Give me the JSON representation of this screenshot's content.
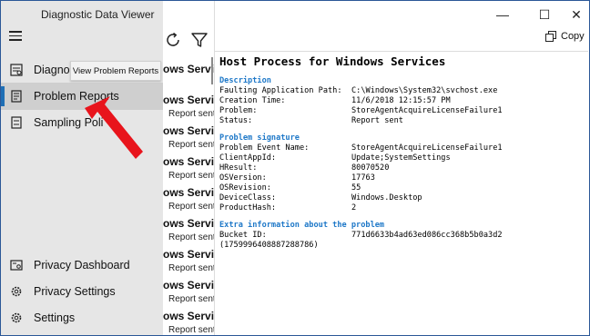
{
  "app": {
    "title": "Diagnostic Data Viewer"
  },
  "window_controls": {
    "minimize": "—",
    "maximize": "☐",
    "close": "✕"
  },
  "colors": {
    "accent": "#1f6fb5",
    "section_heading": "#1e78c8",
    "arrow": "#e8141c",
    "nav_bg": "#e6e6e6"
  },
  "nav": {
    "items": [
      {
        "label": "Diagnos",
        "icon": "diagnostic-icon"
      },
      {
        "label": "Problem Reports",
        "icon": "problem-reports-icon"
      },
      {
        "label": "Sampling Poli",
        "icon": "sampling-icon"
      },
      {
        "label": "Privacy Dashboard",
        "icon": "privacy-dashboard-icon"
      },
      {
        "label": "Privacy Settings",
        "icon": "gear-icon"
      },
      {
        "label": "Settings",
        "icon": "gear-icon"
      }
    ],
    "tooltip": "View Problem Reports"
  },
  "toolbar": {
    "refresh_icon": "refresh-icon",
    "filter_icon": "filter-icon",
    "copy_label": "Copy"
  },
  "list": {
    "items": [
      {
        "title": "ows Services...",
        "status": ""
      },
      {
        "title": "ows Servic...",
        "status": "Report sent"
      },
      {
        "title": "ows Servic...",
        "status": "Report sent"
      },
      {
        "title": "ows Servic...",
        "status": "Report sent"
      },
      {
        "title": "ows Servic...",
        "status": "Report sent"
      },
      {
        "title": "ows Servic...",
        "status": "Report sent"
      },
      {
        "title": "ows Servic...",
        "status": "Report sent"
      },
      {
        "title": "ows Servic...",
        "status": "Report sent"
      },
      {
        "title": "ows Servic...",
        "status": "Report sent"
      }
    ]
  },
  "detail": {
    "title": "Host Process for Windows Services",
    "description_heading": "Description",
    "description": [
      {
        "key": "Faulting Application Path:",
        "value": "C:\\Windows\\System32\\svchost.exe"
      },
      {
        "key": "Creation Time:",
        "value": "11/6/2018 12:15:57 PM"
      },
      {
        "key": "Problem:",
        "value": "StoreAgentAcquireLicenseFailure1"
      },
      {
        "key": "Status:",
        "value": "Report sent"
      }
    ],
    "signature_heading": "Problem signature",
    "signature": [
      {
        "key": "Problem Event Name:",
        "value": "StoreAgentAcquireLicenseFailure1"
      },
      {
        "key": "ClientAppId:",
        "value": "Update;SystemSettings"
      },
      {
        "key": "HResult:",
        "value": "80070520"
      },
      {
        "key": "OSVersion:",
        "value": "17763"
      },
      {
        "key": "OSRevision:",
        "value": "55"
      },
      {
        "key": "DeviceClass:",
        "value": "Windows.Desktop"
      },
      {
        "key": "ProductHash:",
        "value": "2"
      }
    ],
    "extra_heading": "Extra information about the problem",
    "extra": [
      {
        "key": "Bucket ID:",
        "value": "771d6633b4ad63ed086cc368b5b0a3d2"
      }
    ],
    "extra_tail": "(1759996408887288786)"
  }
}
